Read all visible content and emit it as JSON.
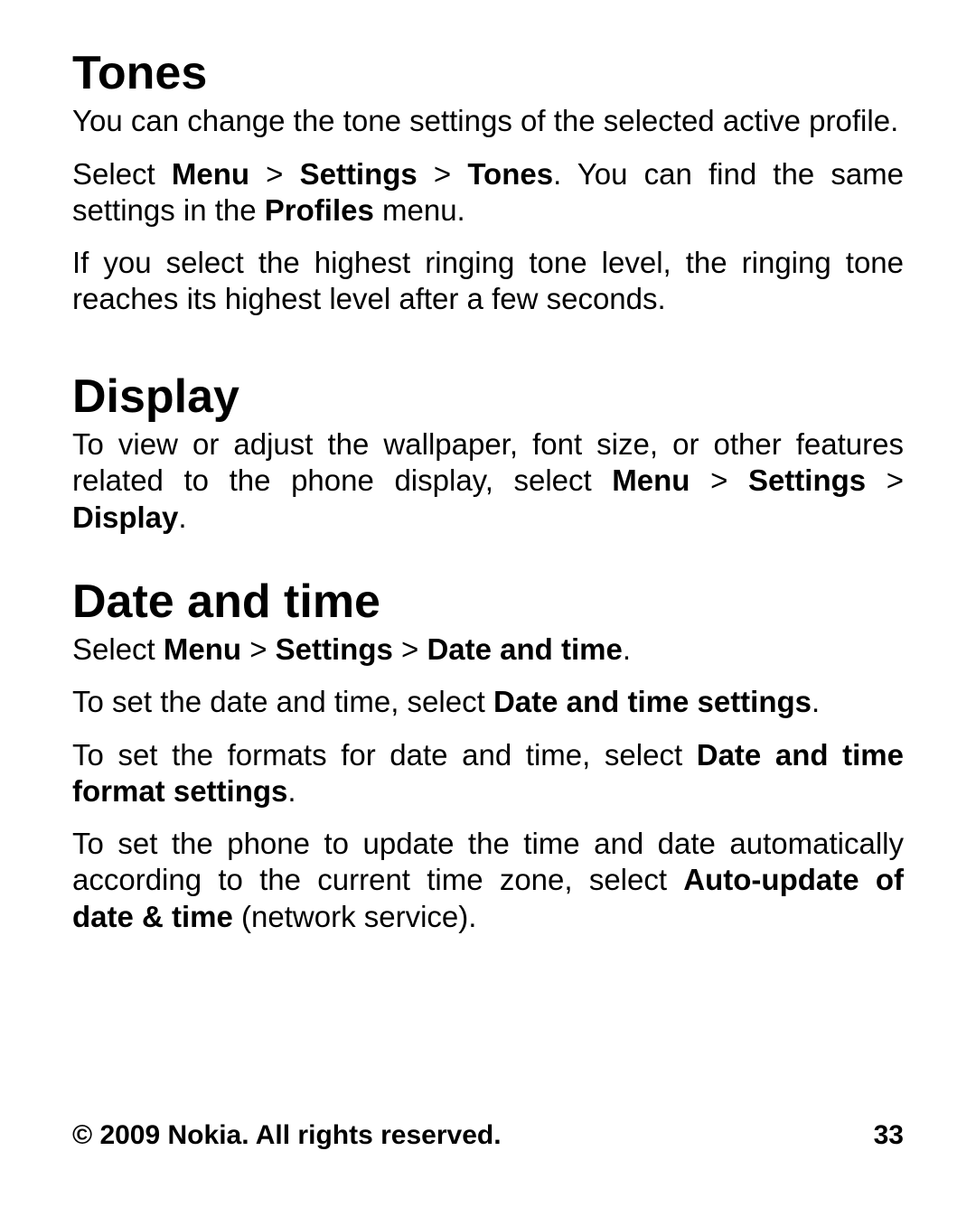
{
  "tones": {
    "heading": "Tones",
    "p1": "You can change the tone settings of the selected active profile.",
    "p2_select": "Select ",
    "p2_menu": "Menu",
    "p2_sep1": " > ",
    "p2_settings": "Settings",
    "p2_sep2": " > ",
    "p2_tones": "Tones",
    "p2_tail_a": ". You can find the same settings in the ",
    "p2_profiles": "Profiles",
    "p2_tail_b": " menu.",
    "p3": "If you select the highest ringing tone level, the ringing tone reaches its highest level after a few seconds."
  },
  "display": {
    "heading": "Display",
    "p1_a": "To view or adjust the wallpaper, font size, or other features related to the phone display, select ",
    "p1_menu": "Menu",
    "p1_sep1": " > ",
    "p1_settings": "Settings",
    "p1_sep2": " > ",
    "p1_display": "Display",
    "p1_tail": "."
  },
  "datetime": {
    "heading": "Date and time",
    "p1_select": "Select ",
    "p1_menu": "Menu",
    "p1_sep1": " > ",
    "p1_settings": "Settings",
    "p1_sep2": " > ",
    "p1_dt": "Date and time",
    "p1_tail": ".",
    "p2_a": "To set the date and time, select ",
    "p2_b": "Date and time settings",
    "p2_tail": ".",
    "p3_a": "To set the formats for date and time, select ",
    "p3_b": "Date and time format settings",
    "p3_tail": ".",
    "p4_a": "To set the phone to update the time and date automatically according to the current time zone, select ",
    "p4_b": "Auto-update of date & time",
    "p4_c": " (network service)."
  },
  "footer": {
    "copyright": "© 2009 Nokia. All rights reserved.",
    "page": "33"
  }
}
